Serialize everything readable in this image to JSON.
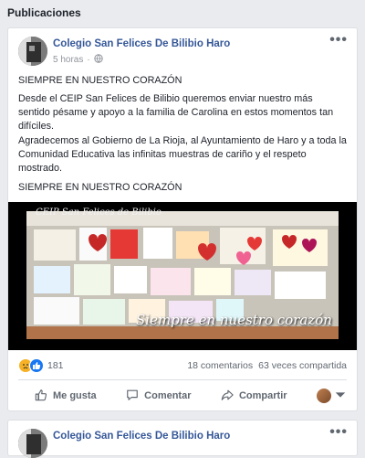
{
  "section": {
    "title": "Publicaciones"
  },
  "post": {
    "page_name": "Colegio San Felices De Bilibio Haro",
    "time": "5 horas",
    "time_sep": "·",
    "more_label": "•••",
    "paragraphs": [
      "SIEMPRE EN NUESTRO CORAZÓN",
      "Desde el CEIP San Felices de Bilibio queremos enviar nuestro más sentido pésame y apoyo a la familia de Carolina en estos momentos tan difíciles.",
      "Agradecemos al Gobierno de La Rioja, al Ayuntamiento de Haro y a toda la Comunidad Educativa las infinitas muestras de cariño y el respeto mostrado.",
      "SIEMPRE EN NUESTRO CORAZÓN"
    ],
    "photo": {
      "caption_top": "CEIP San Felices de Bilibio",
      "caption": "Siempre en nuestro corazón"
    },
    "stats": {
      "reactions_count": "181",
      "comments": "18 comentarios",
      "shares": "63 veces compartida"
    },
    "actions": {
      "like": "Me gusta",
      "comment": "Comentar",
      "share": "Compartir"
    },
    "icons": {
      "like": "thumbs-up-icon",
      "comment": "speech-bubble-icon",
      "share": "share-arrow-icon",
      "globe": "globe-icon"
    },
    "colors": {
      "link": "#365899",
      "like_blue": "#1877f2",
      "sad_yellow": "#f7b125"
    }
  },
  "post2": {
    "page_name": "Colegio San Felices De Bilibio Haro",
    "more_label": "•••"
  }
}
